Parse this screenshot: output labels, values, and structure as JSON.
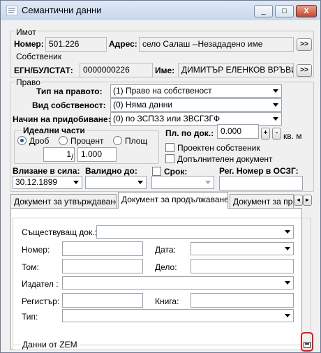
{
  "window": {
    "title": "Семантични данни",
    "min": "_",
    "max": "□",
    "close": "X"
  },
  "owner_section": {
    "imot_legend": "Имот",
    "number_label": "Номер:",
    "number_value": "501.226",
    "address_label": "Адрес:",
    "address_value": "село Салаш --Незададено име",
    "owner_legend": "Собственик",
    "egn_label": "ЕГН/БУЛСТАТ:",
    "egn_value": "0000000226",
    "name_label": "Име:",
    "name_value": "ДИМИТЪР ЕЛЕНКОВ ВРЪВИНОВ",
    "more_button": ">>"
  },
  "right_section": {
    "legend": "Право",
    "type_label": "Тип на правото:",
    "type_value": "(1) Право на собственост",
    "kind_label": "Вид собственост:",
    "kind_value": "(0) Няма данни",
    "acq_label": "Начин на придобиване:",
    "acq_value": "(0) по ЗСПЗЗ или ЗВСГЗГФ",
    "ideal_legend": "Идеални части",
    "radio_fraction": "Дроб",
    "radio_percent": "Процент",
    "radio_area": "Площ",
    "numerator": "1",
    "slash": "/",
    "denominator": "1.000",
    "area_doc_label": "Пл. по док.:",
    "area_doc_value": "0.000",
    "area_unit": "кв. м",
    "plus": "+",
    "minus": "-",
    "projected_owner": "Проектен собственик",
    "extra_document": "Допълнителен документ",
    "valid_from_label": "Влизане в сила:",
    "valid_from_value": "30.12.1899",
    "valid_to_label": "Валидно до:",
    "valid_to_value": "",
    "term_label": "Срок:",
    "reg_label": "Рег. Номер в ОСЗГ:",
    "reg_value": ""
  },
  "tabs": [
    {
      "label": "Документ за утвърждаване"
    },
    {
      "label": "Документ за продължаване"
    },
    {
      "label": "Документ за пре"
    }
  ],
  "tab_arrows": {
    "left": "◄",
    "right": "►"
  },
  "doc_panel": {
    "existing_doc_label": "Съществуващ док.:",
    "number_label": "Номер:",
    "number_value": "",
    "date_label": "Дата:",
    "date_value": "",
    "volume_label": "Том:",
    "volume_value": "",
    "case_label": "Дело:",
    "case_value": "",
    "issuer_label": "Издател :",
    "register_label": "Регистър:",
    "register_value": "",
    "book_label": "Книга:",
    "book_value": "",
    "type_label": "Тип:",
    "zem_legend": "Данни от ZEM"
  },
  "colors": {
    "highlight": "#e3161b"
  }
}
